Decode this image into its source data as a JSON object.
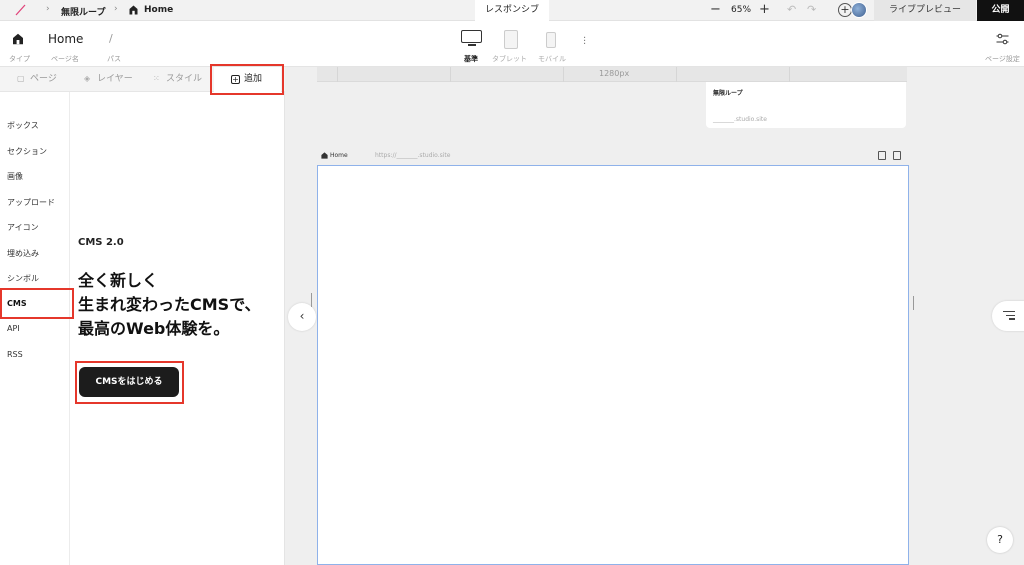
{
  "topbar": {
    "breadcrumb": [
      {
        "label": "無限ループ"
      },
      {
        "label": "Home",
        "icon": "home-icon"
      }
    ],
    "center_tab": "レスポンシブ",
    "zoom": {
      "minus": "−",
      "value": "65%",
      "plus": "+"
    },
    "live_preview": "ライブプレビュー",
    "publish": "公開"
  },
  "page_header": {
    "type_label": "タイプ",
    "page_name": "Home",
    "page_name_label": "ページ名",
    "path": "/",
    "path_label": "パス",
    "devices": [
      {
        "label": "基準",
        "active": true
      },
      {
        "label": "タブレット",
        "active": false
      },
      {
        "label": "モバイル",
        "active": false
      }
    ],
    "settings_label": "ページ設定"
  },
  "left_panel": {
    "tabs": [
      {
        "label": "ページ",
        "icon": "page-icon"
      },
      {
        "label": "レイヤー",
        "icon": "layers-icon"
      },
      {
        "label": "スタイル",
        "icon": "style-icon"
      },
      {
        "label": "追加",
        "icon": "add-icon",
        "active": true
      }
    ],
    "categories": [
      "ボックス",
      "セクション",
      "画像",
      "アップロード",
      "アイコン",
      "埋め込み",
      "シンボル",
      "CMS",
      "API",
      "RSS"
    ],
    "active_category": "CMS",
    "cms": {
      "version": "CMS 2.0",
      "headline": [
        "全く新しく",
        "生まれ変わったCMSで、",
        "最高のWeb体験を。"
      ],
      "button": "CMSをはじめる"
    }
  },
  "canvas": {
    "ruler_label": "1280px",
    "site_card": {
      "name": "無限ループ",
      "url": "_______.studio.site"
    },
    "frame": {
      "page_name": "Home",
      "url": "https://_______.studio.site"
    }
  },
  "help": "?",
  "colors": {
    "highlight": "#e5372b",
    "frame_border": "#8fb2ea",
    "publish_bg": "#111111"
  }
}
